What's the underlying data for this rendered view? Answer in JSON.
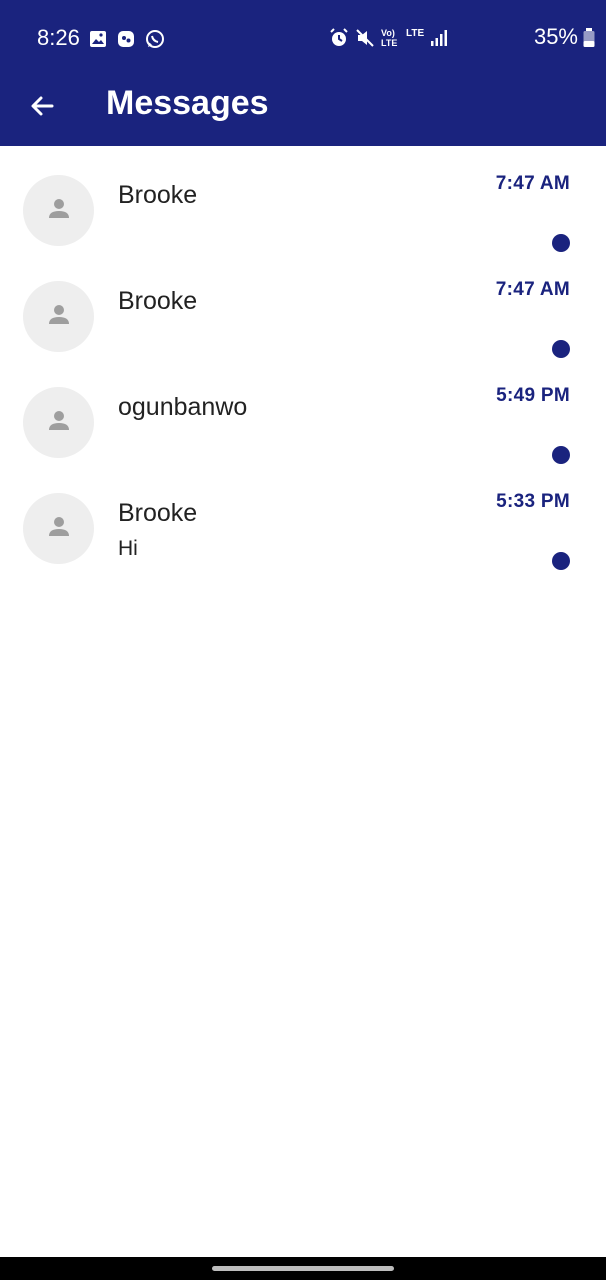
{
  "status_bar": {
    "time": "8:26",
    "battery": "35%",
    "left_icons": [
      "image-icon",
      "app-notification-icon",
      "whatsapp-icon"
    ],
    "right_icons": [
      "alarm-icon",
      "mute-icon",
      "volte-icon",
      "lte-icon",
      "signal-icon",
      "battery-icon"
    ],
    "volte_label": "Vo) LTE",
    "lte_label": "LTE"
  },
  "app_bar": {
    "title": "Messages",
    "back_icon": "arrow-back-icon"
  },
  "conversations": [
    {
      "name": "Brooke",
      "preview": "",
      "time": "7:47 AM",
      "unread": true
    },
    {
      "name": "Brooke",
      "preview": "",
      "time": "7:47 AM",
      "unread": true
    },
    {
      "name": "ogunbanwo",
      "preview": "",
      "time": "5:49 PM",
      "unread": true
    },
    {
      "name": "Brooke",
      "preview": "Hi",
      "time": "5:33 PM",
      "unread": true
    }
  ],
  "colors": {
    "primary": "#1a237e",
    "avatar_bg": "#eeeeee",
    "avatar_icon": "#9e9e9e"
  }
}
